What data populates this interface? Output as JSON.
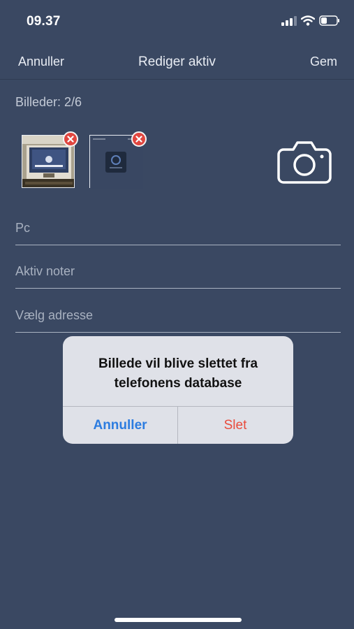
{
  "status_bar": {
    "time": "09.37",
    "icons": [
      "signal-icon",
      "wifi-icon",
      "battery-icon"
    ]
  },
  "nav": {
    "left_label": "Annuller",
    "title": "Rediger aktiv",
    "right_label": "Gem"
  },
  "images": {
    "count_label": "Billeder: 2/6",
    "thumbnails": [
      {
        "name": "photo-thumbnail-1",
        "remove_icon": "close-icon"
      },
      {
        "name": "photo-thumbnail-2",
        "remove_icon": "close-icon"
      }
    ],
    "camera_icon": "camera-icon"
  },
  "fields": {
    "name_value": "Pc",
    "notes_placeholder": "Aktiv noter",
    "address_placeholder": "Vælg adresse"
  },
  "alert": {
    "message": "Billede vil blive slettet fra telefonens database",
    "cancel_label": "Annuller",
    "delete_label": "Slet"
  },
  "colors": {
    "background": "#3a4862",
    "accent_blue": "#2c7ce0",
    "destructive_red": "#e94b3c",
    "badge_red": "#e0463f"
  }
}
